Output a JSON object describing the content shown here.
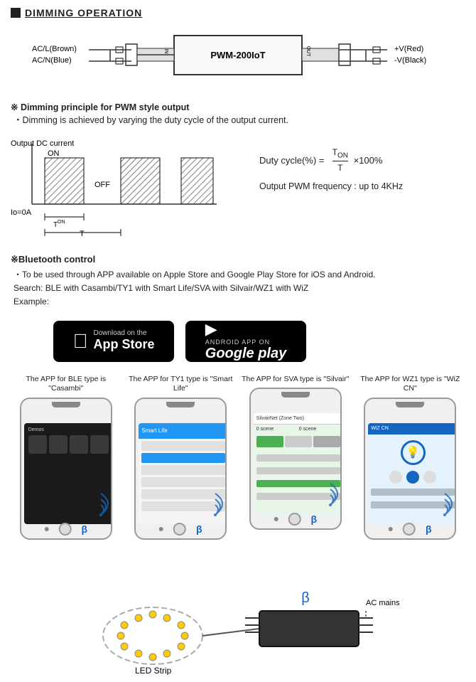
{
  "section": {
    "title": "DIMMING OPERATION"
  },
  "wiring": {
    "left_label1": "AC/L(Brown)",
    "left_label2": "AC/N(Blue)",
    "device_label": "PWM-200IoT",
    "right_label1": "+V(Red)",
    "right_label2": "-V(Black)"
  },
  "dimming_principle": {
    "title": "※ Dimming principle for PWM style output",
    "note": "・Dimming is achieved by varying the duty cycle of the output current."
  },
  "pwm": {
    "y_label": "Output DC current",
    "on_label": "ON",
    "off_label": "OFF",
    "io_label": "Io=0A",
    "ton_label": "TON",
    "t_label": "T"
  },
  "formula": {
    "text": "Duty cycle(%) =",
    "numerator": "TON",
    "denominator": "T",
    "multiplier": "×100%",
    "freq_text": "Output PWM frequency : up to 4KHz"
  },
  "bluetooth": {
    "title": "※Bluetooth control",
    "note_line1": "・To be used through APP available on Apple Store and Google Play Store for iOS and Android.",
    "note_line2": "Search: BLE with Casambi/TY1 with Smart Life/SVA with Silvair/WZ1 with WiZ",
    "note_line3": "Example:"
  },
  "app_store": {
    "small_text": "Download on the",
    "large_text": "App Store"
  },
  "google_play": {
    "small_text": "ANDROID APP ON",
    "large_text": "Google play"
  },
  "phones": [
    {
      "label": "The APP for BLE type is \"Casambi\"",
      "app_type": "casambi"
    },
    {
      "label": "The APP for TY1 type is \"Smart Life\"",
      "app_type": "smart-life"
    },
    {
      "label": "The APP for SVA type is \"Silvair\"",
      "app_type": "silvair"
    },
    {
      "label": "The APP for WZ1 type is \"WiZ CN\"",
      "app_type": "wiz"
    }
  ],
  "bottom": {
    "bt_label": "AC mains",
    "led_label": "LED Strip"
  }
}
